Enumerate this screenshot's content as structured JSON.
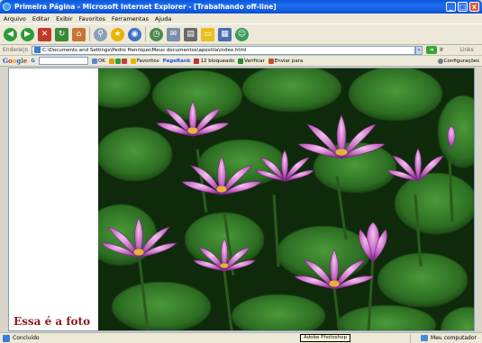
{
  "window": {
    "title": "Primeira Página - Microsoft Internet Explorer - [Trabalhando off-line]",
    "minimize": "_",
    "maximize": "□",
    "close": "x"
  },
  "menu": [
    "Arquivo",
    "Editar",
    "Exibir",
    "Favoritos",
    "Ferramentas",
    "Ajuda"
  ],
  "toolbar": {
    "icons": [
      "back-icon",
      "forward-icon",
      "stop-icon",
      "refresh-icon",
      "home-icon",
      "search-icon",
      "favorites-icon",
      "media-icon",
      "history-icon",
      "mail-icon",
      "print-icon",
      "edit-icon",
      "folder-icon",
      "discuss-icon",
      "messenger-icon"
    ]
  },
  "address": {
    "label": "Endereço",
    "value": "C:\\Documents and Settings\\Pedro Henrique\\Meus documentos\\apostila\\index.html",
    "go": "Ir",
    "links": "Links"
  },
  "googlebar": {
    "logo": "Google",
    "search_dropdown": "G",
    "items": [
      "OK",
      "Favoritos",
      "PageRank",
      "12 bloqueado",
      "Verificar",
      "Enviar para"
    ],
    "settings": "Configurações"
  },
  "page": {
    "caption": "Essa é a foto",
    "image_alt": "Flores de lótus roxas sobre folhas verdes"
  },
  "status": {
    "text": "Concluído",
    "tooltip": "Adobe Photoshop",
    "zone": "Meu computador"
  },
  "colors": {
    "title_blue": "#0a57d8",
    "caption_red": "#8b1a1a",
    "chrome": "#ece9d8"
  }
}
